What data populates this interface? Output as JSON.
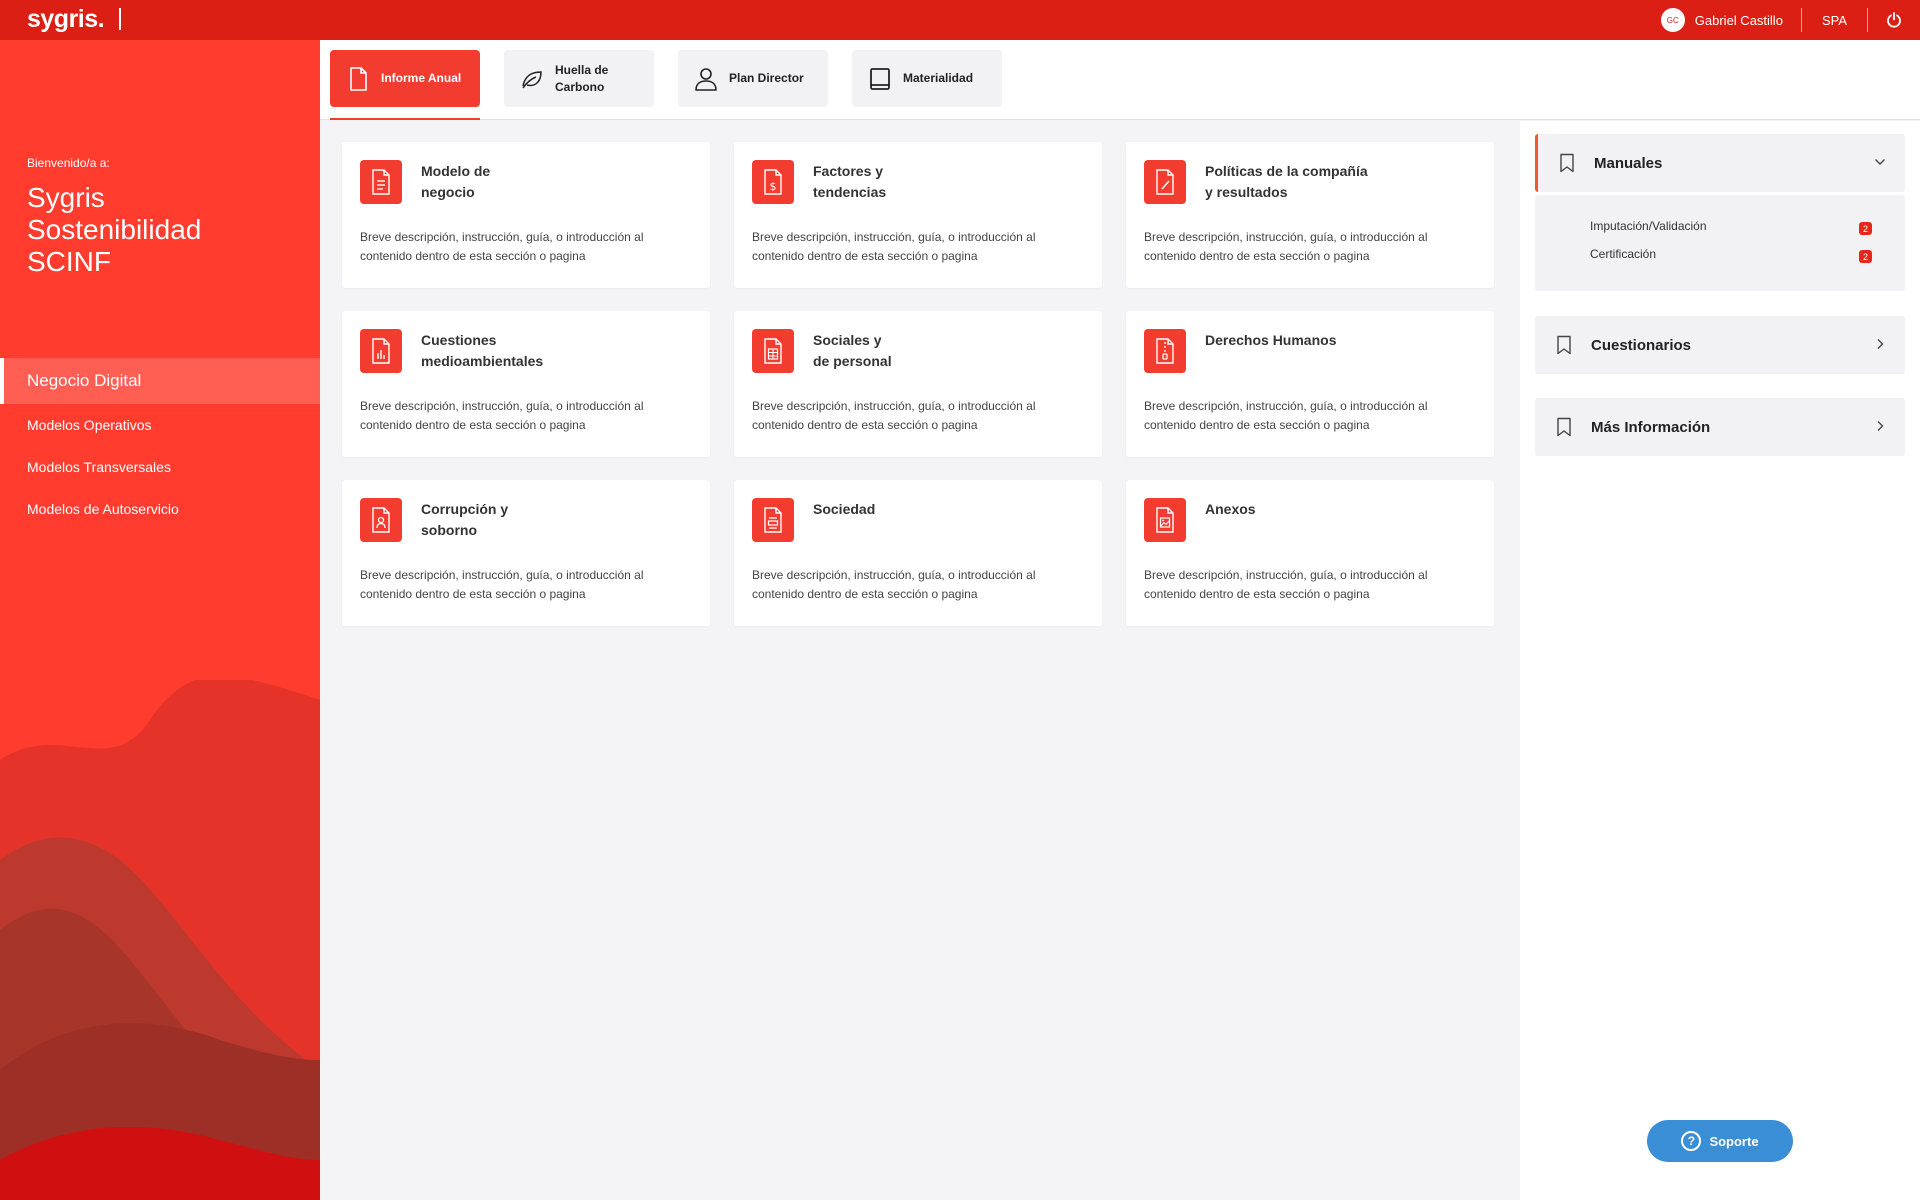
{
  "header": {
    "logo": "sygris.",
    "user_initials": "GC",
    "user_name": "Gabriel Castillo",
    "language": "SPA"
  },
  "sidebar": {
    "welcome": "Bienvenido/a a:",
    "title_line1": "Sygris",
    "title_line2": "Sostenibilidad",
    "title_line3": "SCINF",
    "items": [
      {
        "label": "Negocio Digital"
      },
      {
        "label": "Modelos Operativos"
      },
      {
        "label": "Modelos Transversales"
      },
      {
        "label": "Modelos de Autoservicio"
      }
    ]
  },
  "tabs": [
    {
      "label": "Informe Anual",
      "icon": "document-icon"
    },
    {
      "label": "Huella de Carbono",
      "icon": "leaf-icon"
    },
    {
      "label": "Plan Director",
      "icon": "user-icon"
    },
    {
      "label": "Materialidad",
      "icon": "book-icon"
    }
  ],
  "cards": [
    {
      "title": "Modelo de\nnegocio",
      "desc": "Breve descripción, instrucción, guía, o introducción al contenido dentro de esta sección o pagina",
      "icon": "document-lines-icon"
    },
    {
      "title": "Factores y\ntendencias",
      "desc": "Breve descripción, instrucción, guía, o introducción al contenido dentro de esta sección o pagina",
      "icon": "document-dollar-icon"
    },
    {
      "title": "Políticas de la compañía\ny resultados",
      "desc": "Breve descripción, instrucción, guía, o introducción al contenido dentro de esta sección o pagina",
      "icon": "document-edit-icon"
    },
    {
      "title": "Cuestiones\nmedioambientales",
      "desc": "Breve descripción, instrucción, guía, o introducción al contenido dentro de esta sección o pagina",
      "icon": "document-chart-icon"
    },
    {
      "title": "Sociales y\nde personal",
      "desc": "Breve descripción, instrucción, guía, o introducción al contenido dentro de esta sección o pagina",
      "icon": "document-table-icon"
    },
    {
      "title": "Derechos Humanos",
      "desc": "Breve descripción, instrucción, guía, o introducción al contenido dentro de esta sección o pagina",
      "icon": "document-zip-icon"
    },
    {
      "title": "Corrupción y\nsoborno",
      "desc": "Breve descripción, instrucción, guía, o introducción al contenido dentro de esta sección o pagina",
      "icon": "document-person-icon"
    },
    {
      "title": "Sociedad",
      "desc": "Breve descripción, instrucción, guía, o introducción al contenido dentro de esta sección o pagina",
      "icon": "document-form-icon"
    },
    {
      "title": "Anexos",
      "desc": "Breve descripción, instrucción, guía, o introducción al contenido dentro de esta sección o pagina",
      "icon": "document-image-icon"
    }
  ],
  "right_panel": {
    "manuales": {
      "title": "Manuales",
      "items": [
        {
          "label": "Imputación/Validación",
          "badge": "2"
        },
        {
          "label": "Certificación",
          "badge": "2"
        }
      ]
    },
    "cuestionarios": {
      "title": "Cuestionarios"
    },
    "mas_informacion": {
      "title": "Más Información"
    }
  },
  "support": {
    "label": "Soporte"
  },
  "colors": {
    "brand_red": "#dc1f15",
    "accent_red": "#f23c2f",
    "support_blue": "#3a8ed6"
  }
}
